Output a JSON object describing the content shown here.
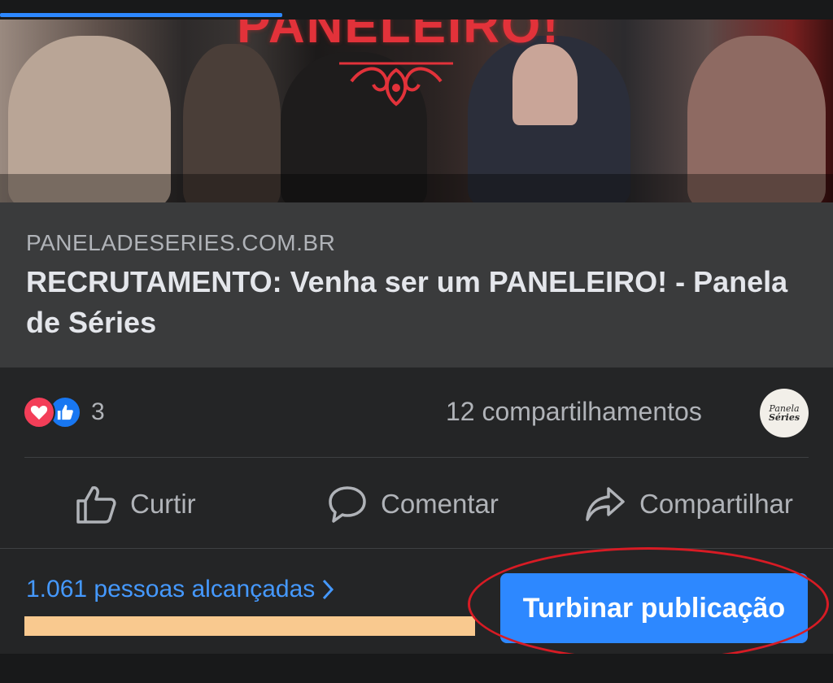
{
  "hero": {
    "banner_text": "PANELEIRO!"
  },
  "link": {
    "domain": "PANELADESERIES.COM.BR",
    "title": "RECRUTAMENTO: Venha ser um PANELEIRO! - Panela de Séries"
  },
  "stats": {
    "reaction_count": "3",
    "shares_label": "12 compartilhamentos",
    "reaction_icons": [
      "love-icon",
      "like-icon"
    ]
  },
  "page_avatar": {
    "line1": "Panela",
    "line2": "Séries"
  },
  "actions": {
    "like": "Curtir",
    "comment": "Comentar",
    "share": "Compartilhar"
  },
  "reach": {
    "label": "1.061 pessoas alcançadas"
  },
  "boost_button": "Turbinar publicação",
  "colors": {
    "background": "#242526",
    "link_box": "#3a3b3c",
    "accent": "#2d88ff",
    "reach_text": "#4599ff",
    "reach_bar": "#f9c98f",
    "highlight_ring": "#d81b24"
  }
}
